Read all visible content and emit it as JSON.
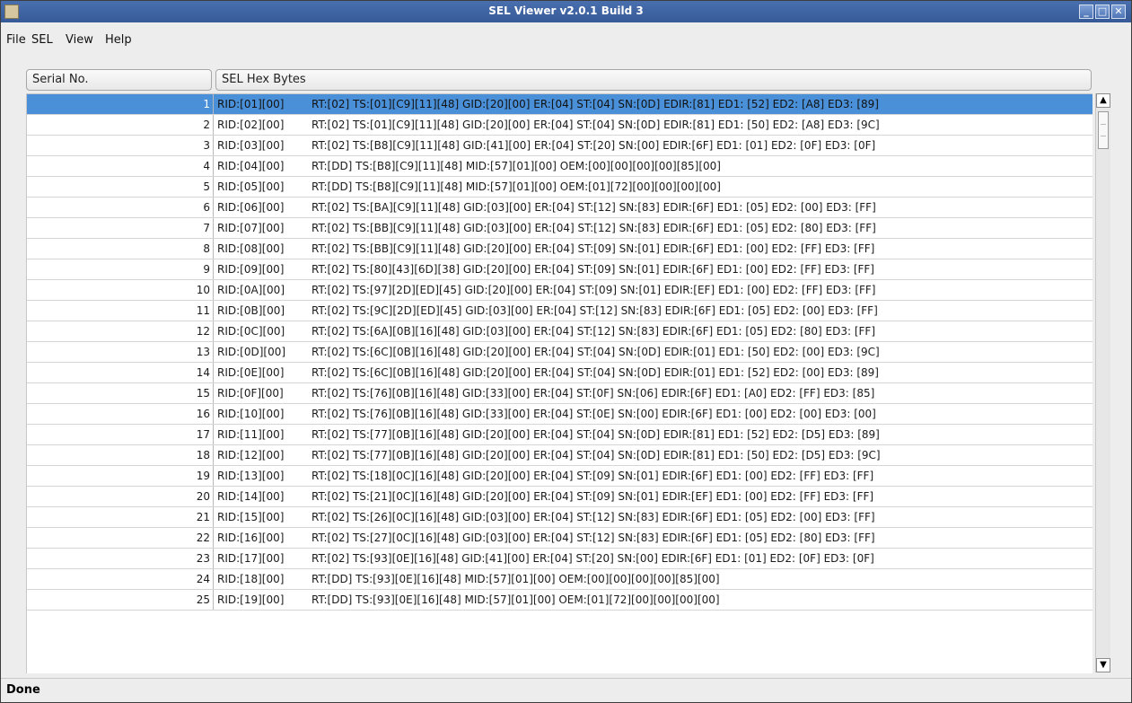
{
  "window": {
    "title": "SEL Viewer v2.0.1 Build 3",
    "controls": [
      "minimize",
      "maximize",
      "close"
    ]
  },
  "menubar": {
    "items": [
      "File",
      "SEL",
      "View",
      "Help"
    ]
  },
  "table": {
    "columns": [
      "Serial No.",
      "SEL Hex Bytes"
    ],
    "rows": [
      {
        "serial": "1",
        "rid": "RID:[01][00]",
        "data": "RT:[02] TS:[01][C9][11][48] GID:[20][00] ER:[04] ST:[04] SN:[0D] EDIR:[81] ED1: [52] ED2: [A8] ED3: [89]"
      },
      {
        "serial": "2",
        "rid": "RID:[02][00]",
        "data": "RT:[02] TS:[01][C9][11][48] GID:[20][00] ER:[04] ST:[04] SN:[0D] EDIR:[81] ED1: [50] ED2: [A8] ED3: [9C]"
      },
      {
        "serial": "3",
        "rid": "RID:[03][00]",
        "data": "RT:[02] TS:[B8][C9][11][48] GID:[41][00] ER:[04] ST:[20] SN:[00] EDIR:[6F] ED1: [01] ED2: [0F] ED3: [0F]"
      },
      {
        "serial": "4",
        "rid": "RID:[04][00]",
        "data": "RT:[DD] TS:[B8][C9][11][48] MID:[57][01][00] OEM:[00][00][00][00][85][00]"
      },
      {
        "serial": "5",
        "rid": "RID:[05][00]",
        "data": "RT:[DD] TS:[B8][C9][11][48] MID:[57][01][00] OEM:[01][72][00][00][00][00]"
      },
      {
        "serial": "6",
        "rid": "RID:[06][00]",
        "data": "RT:[02] TS:[BA][C9][11][48] GID:[03][00] ER:[04] ST:[12] SN:[83] EDIR:[6F] ED1: [05] ED2: [00] ED3: [FF]"
      },
      {
        "serial": "7",
        "rid": "RID:[07][00]",
        "data": "RT:[02] TS:[BB][C9][11][48] GID:[03][00] ER:[04] ST:[12] SN:[83] EDIR:[6F] ED1: [05] ED2: [80] ED3: [FF]"
      },
      {
        "serial": "8",
        "rid": "RID:[08][00]",
        "data": "RT:[02] TS:[BB][C9][11][48] GID:[20][00] ER:[04] ST:[09] SN:[01] EDIR:[6F] ED1: [00] ED2: [FF] ED3: [FF]"
      },
      {
        "serial": "9",
        "rid": "RID:[09][00]",
        "data": "RT:[02] TS:[80][43][6D][38] GID:[20][00] ER:[04] ST:[09] SN:[01] EDIR:[6F] ED1: [00] ED2: [FF] ED3: [FF]"
      },
      {
        "serial": "10",
        "rid": "RID:[0A][00]",
        "data": "RT:[02] TS:[97][2D][ED][45] GID:[20][00] ER:[04] ST:[09] SN:[01] EDIR:[EF] ED1: [00] ED2: [FF] ED3: [FF]"
      },
      {
        "serial": "11",
        "rid": "RID:[0B][00]",
        "data": "RT:[02] TS:[9C][2D][ED][45] GID:[03][00] ER:[04] ST:[12] SN:[83] EDIR:[6F] ED1: [05] ED2: [00] ED3: [FF]"
      },
      {
        "serial": "12",
        "rid": "RID:[0C][00]",
        "data": "RT:[02] TS:[6A][0B][16][48] GID:[03][00] ER:[04] ST:[12] SN:[83] EDIR:[6F] ED1: [05] ED2: [80] ED3: [FF]"
      },
      {
        "serial": "13",
        "rid": "RID:[0D][00]",
        "data": "RT:[02] TS:[6C][0B][16][48] GID:[20][00] ER:[04] ST:[04] SN:[0D] EDIR:[01] ED1: [50] ED2: [00] ED3: [9C]"
      },
      {
        "serial": "14",
        "rid": "RID:[0E][00]",
        "data": "RT:[02] TS:[6C][0B][16][48] GID:[20][00] ER:[04] ST:[04] SN:[0D] EDIR:[01] ED1: [52] ED2: [00] ED3: [89]"
      },
      {
        "serial": "15",
        "rid": "RID:[0F][00]",
        "data": "RT:[02] TS:[76][0B][16][48] GID:[33][00] ER:[04] ST:[0F] SN:[06] EDIR:[6F] ED1: [A0] ED2: [FF] ED3: [85]"
      },
      {
        "serial": "16",
        "rid": "RID:[10][00]",
        "data": "RT:[02] TS:[76][0B][16][48] GID:[33][00] ER:[04] ST:[0E] SN:[00] EDIR:[6F] ED1: [00] ED2: [00] ED3: [00]"
      },
      {
        "serial": "17",
        "rid": "RID:[11][00]",
        "data": "RT:[02] TS:[77][0B][16][48] GID:[20][00] ER:[04] ST:[04] SN:[0D] EDIR:[81] ED1: [52] ED2: [D5] ED3: [89]"
      },
      {
        "serial": "18",
        "rid": "RID:[12][00]",
        "data": "RT:[02] TS:[77][0B][16][48] GID:[20][00] ER:[04] ST:[04] SN:[0D] EDIR:[81] ED1: [50] ED2: [D5] ED3: [9C]"
      },
      {
        "serial": "19",
        "rid": "RID:[13][00]",
        "data": "RT:[02] TS:[18][0C][16][48] GID:[20][00] ER:[04] ST:[09] SN:[01] EDIR:[6F] ED1: [00] ED2: [FF] ED3: [FF]"
      },
      {
        "serial": "20",
        "rid": "RID:[14][00]",
        "data": "RT:[02] TS:[21][0C][16][48] GID:[20][00] ER:[04] ST:[09] SN:[01] EDIR:[EF] ED1: [00] ED2: [FF] ED3: [FF]"
      },
      {
        "serial": "21",
        "rid": "RID:[15][00]",
        "data": "RT:[02] TS:[26][0C][16][48] GID:[03][00] ER:[04] ST:[12] SN:[83] EDIR:[6F] ED1: [05] ED2: [00] ED3: [FF]"
      },
      {
        "serial": "22",
        "rid": "RID:[16][00]",
        "data": "RT:[02] TS:[27][0C][16][48] GID:[03][00] ER:[04] ST:[12] SN:[83] EDIR:[6F] ED1: [05] ED2: [80] ED3: [FF]"
      },
      {
        "serial": "23",
        "rid": "RID:[17][00]",
        "data": "RT:[02] TS:[93][0E][16][48] GID:[41][00] ER:[04] ST:[20] SN:[00] EDIR:[6F] ED1: [01] ED2: [0F] ED3: [0F]"
      },
      {
        "serial": "24",
        "rid": "RID:[18][00]",
        "data": "RT:[DD] TS:[93][0E][16][48] MID:[57][01][00] OEM:[00][00][00][00][85][00]"
      },
      {
        "serial": "25",
        "rid": "RID:[19][00]",
        "data": "RT:[DD] TS:[93][0E][16][48] MID:[57][01][00] OEM:[01][72][00][00][00][00]"
      }
    ],
    "selected_row": "1"
  },
  "status": {
    "text": "Done"
  },
  "colors": {
    "title_bar": "#3f66a6",
    "selection": "#4a90d9",
    "background": "#ededed"
  },
  "icons": {
    "app": "java-app-icon",
    "scroll_up": "scroll-up-arrow-icon",
    "scroll_down": "scroll-down-arrow-icon"
  }
}
